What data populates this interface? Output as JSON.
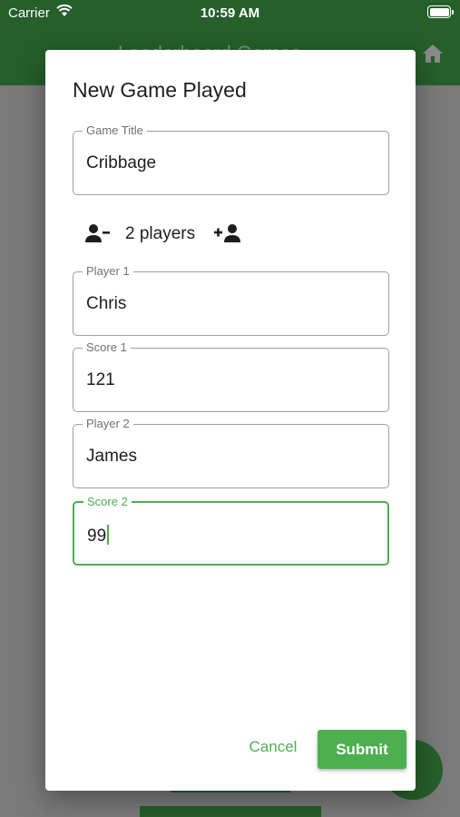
{
  "status_bar": {
    "carrier": "Carrier",
    "time": "10:59 AM",
    "wifi_icon": "wifi-icon",
    "battery_icon": "battery-icon"
  },
  "app_bar": {
    "title": "Leaderboard Games",
    "home_icon": "home-icon",
    "background": "#255f2a"
  },
  "dialog": {
    "title": "New Game Played",
    "game_title": {
      "label": "Game Title",
      "value": "Cribbage"
    },
    "players_control": {
      "remove_icon": "person-remove-icon",
      "count_label": "2 players",
      "add_icon": "person-add-icon"
    },
    "fields": [
      {
        "label": "Player 1",
        "value": "Chris"
      },
      {
        "label": "Score 1",
        "value": "121"
      },
      {
        "label": "Player 2",
        "value": "James"
      },
      {
        "label": "Score 2",
        "value": "99"
      }
    ],
    "cancel_label": "Cancel",
    "submit_label": "Submit"
  },
  "colors": {
    "accent": "#4caf50",
    "app_bar": "#255f2a",
    "overlay": "#7a7a7a"
  }
}
